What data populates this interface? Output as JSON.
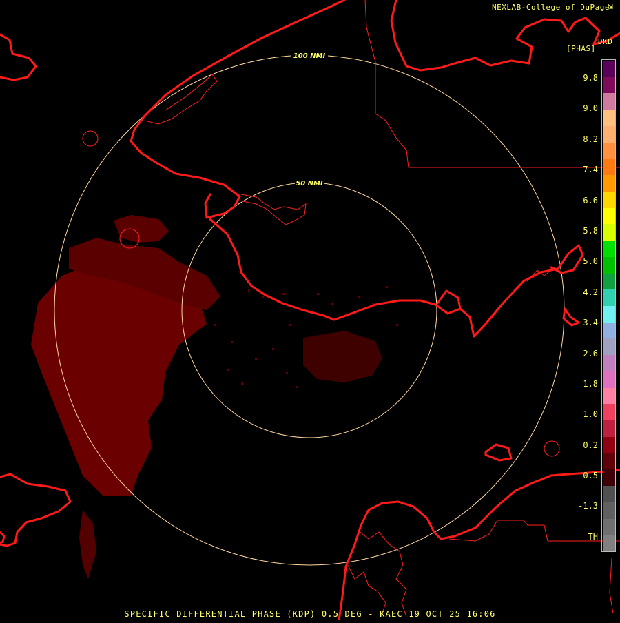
{
  "header": {
    "brand": "NEXLAB-College of DuPage",
    "product_code": "DKD",
    "units": "[PHAS]"
  },
  "rings": [
    {
      "label": "100 NMI"
    },
    {
      "label": "50 NMI"
    }
  ],
  "legend": {
    "labels": [
      "9.8",
      "9.0",
      "8.2",
      "7.4",
      "6.6",
      "5.8",
      "5.0",
      "4.2",
      "3.4",
      "2.6",
      "1.8",
      "1.0",
      "0.2",
      "-0.5",
      "-1.3",
      "TH"
    ],
    "colors": [
      "#5a005a",
      "#7d0a5a",
      "#d07aa0",
      "#ffc080",
      "#ffb070",
      "#ff9040",
      "#ff7a10",
      "#ff9a00",
      "#ffd800",
      "#ffff00",
      "#d8ff00",
      "#00e000",
      "#00c000",
      "#10a040",
      "#30d0b0",
      "#70f0f0",
      "#8fb0e0",
      "#a0a0c0",
      "#c080c0",
      "#e070c0",
      "#ff80a0",
      "#f04060",
      "#c02040",
      "#900010",
      "#600008",
      "#400008",
      "#505050",
      "#606060",
      "#707070",
      "#808080"
    ]
  },
  "colors": {
    "map_lines": "#ff1a1a",
    "rings": "#ffd7a0",
    "echo": "#700000",
    "text": "#ffff66"
  },
  "footer": {
    "text": "SPECIFIC DIFFERENTIAL PHASE (KDP) 0.5 DEG - KAEC 19 OCT 25 16:06"
  }
}
